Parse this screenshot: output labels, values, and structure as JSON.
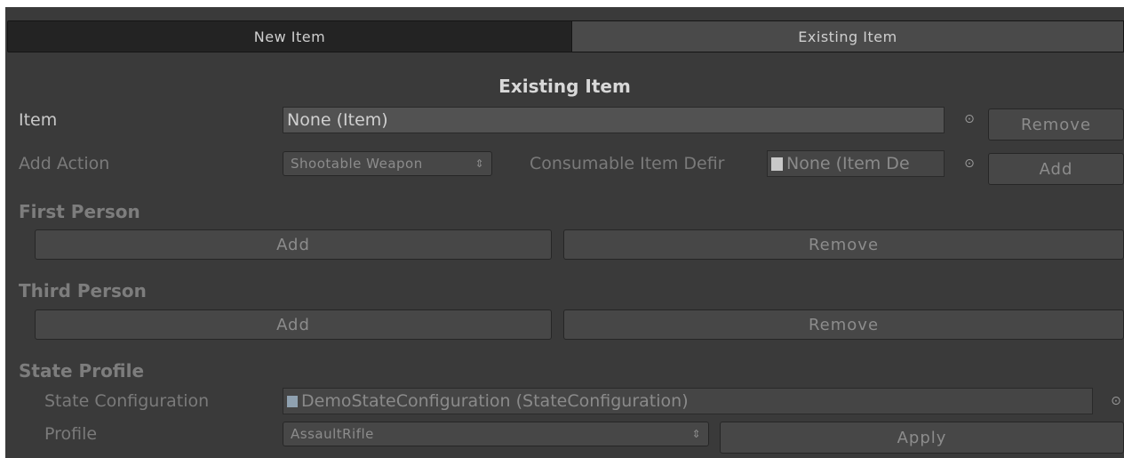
{
  "tabs": [
    {
      "label": "New Item"
    },
    {
      "label": "Existing Item"
    }
  ],
  "heading": "Existing Item",
  "item_row": {
    "label": "Item",
    "value": "None (Item)",
    "remove_label": "Remove"
  },
  "action_row": {
    "label": "Add Action",
    "action_type": "Shootable Weapon",
    "consumable_label": "Consumable Item Defir",
    "consumable_value": "None (Item De",
    "add_label": "Add"
  },
  "first_person": {
    "title": "First Person",
    "add_label": "Add",
    "remove_label": "Remove"
  },
  "third_person": {
    "title": "Third Person",
    "add_label": "Add",
    "remove_label": "Remove"
  },
  "state_profile": {
    "title": "State Profile",
    "config_label": "State Configuration",
    "config_value": "DemoStateConfiguration (StateConfiguration)",
    "profile_label": "Profile",
    "profile_value": "AssaultRifle",
    "apply_label": "Apply"
  },
  "icons": {
    "object_picker": "object-picker-icon",
    "popup_arrow": "popup-arrow-icon",
    "document": "document-icon",
    "state_config": "state-config-icon"
  }
}
